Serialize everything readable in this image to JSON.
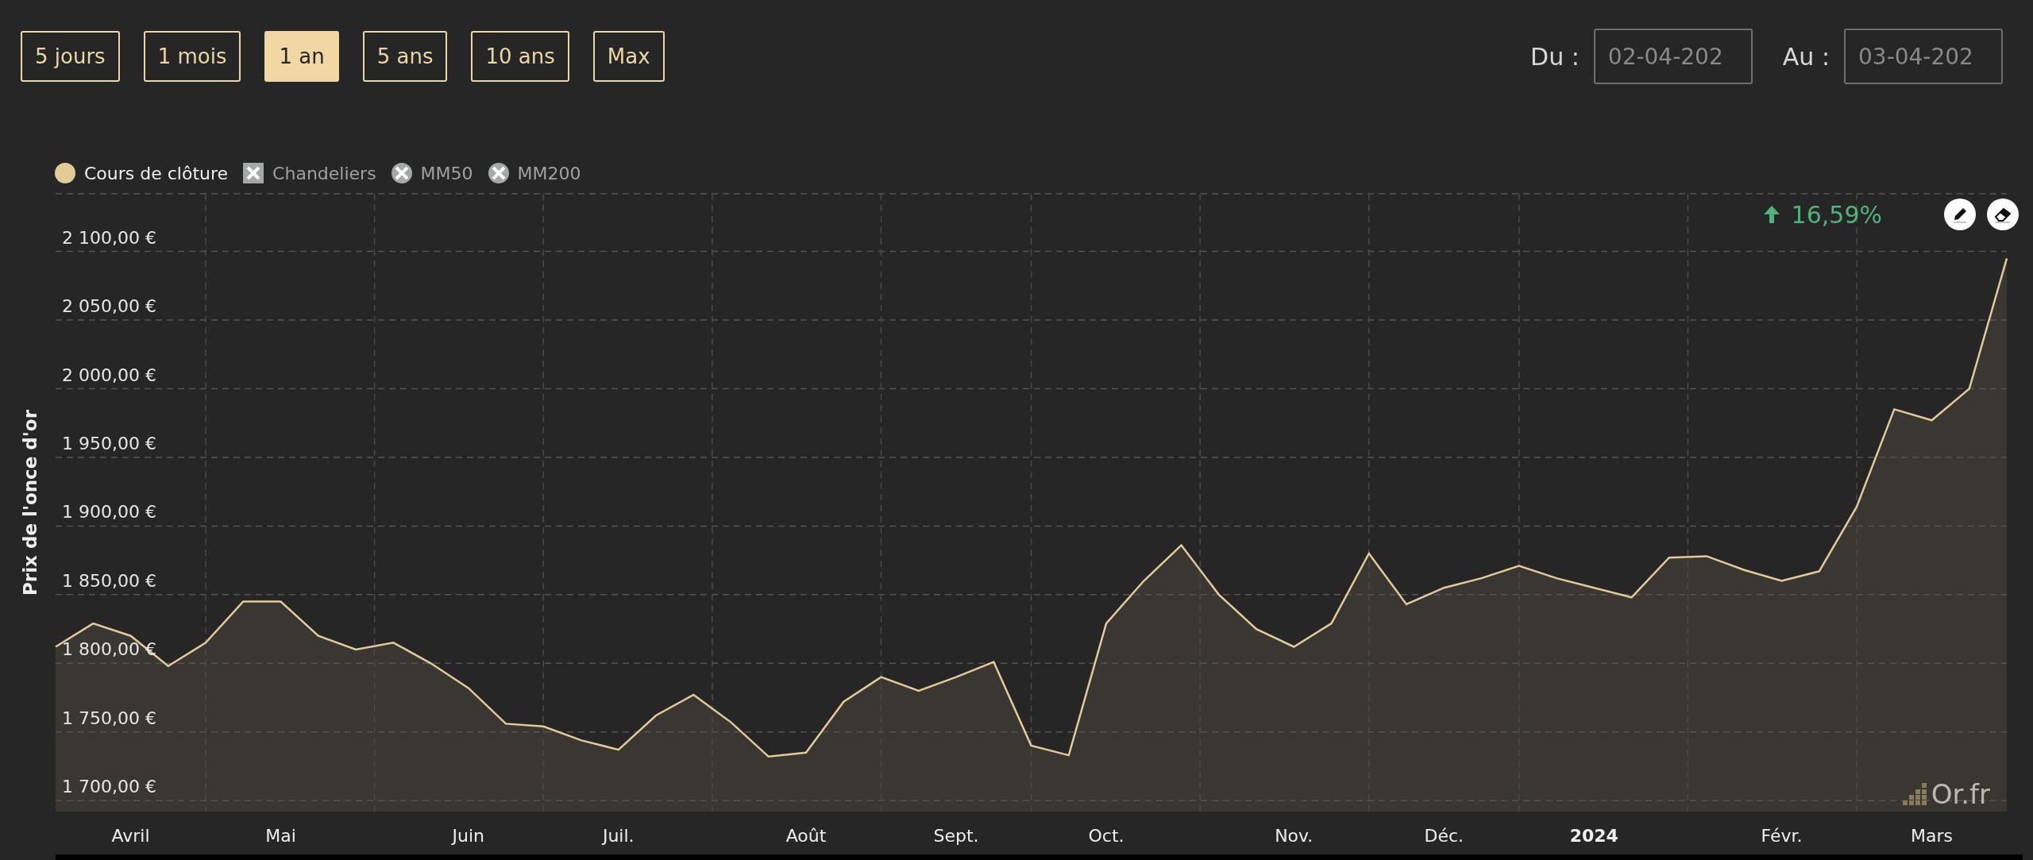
{
  "periods": [
    {
      "label": "5 jours",
      "selected": false
    },
    {
      "label": "1 mois",
      "selected": false
    },
    {
      "label": "1 an",
      "selected": true
    },
    {
      "label": "5 ans",
      "selected": false
    },
    {
      "label": "10 ans",
      "selected": false
    },
    {
      "label": "Max",
      "selected": false
    }
  ],
  "date_range": {
    "from_label": "Du :",
    "from_value": "02-04-202",
    "to_label": "Au :",
    "to_value": "03-04-202"
  },
  "legend": [
    {
      "kind": "circle",
      "enabled": true
    },
    {
      "label": "Chandeliers",
      "kind": "square",
      "enabled": false
    },
    {
      "label": "MM50",
      "kind": "circle",
      "enabled": false
    },
    {
      "label": "MM200",
      "kind": "circle",
      "enabled": false
    }
  ],
  "change": {
    "text": "16,59%"
  },
  "watermark_logo": "Or.fr",
  "chart": {
    "chart_data": {
      "type": "area",
      "grid": true,
      "ylabel": "Prix de l'once d'or",
      "ylim": [
        1692,
        2142
      ],
      "yticks": [
        {
          "value": 1700,
          "label": "1 700,00 €"
        },
        {
          "value": 1750,
          "label": "1 750,00 €"
        },
        {
          "value": 1800,
          "label": "1 800,00 €"
        },
        {
          "value": 1850,
          "label": "1 850,00 €"
        },
        {
          "value": 1900,
          "label": "1 900,00 €"
        },
        {
          "value": 1950,
          "label": "1 950,00 €"
        },
        {
          "value": 2000,
          "label": "2 000,00 €"
        },
        {
          "value": 2050,
          "label": "2 050,00 €"
        },
        {
          "value": 2100,
          "label": "2 100,00 €"
        }
      ],
      "categories": [
        null,
        null,
        "Avril",
        null,
        null,
        null,
        "Mai",
        null,
        null,
        null,
        null,
        "Juin",
        null,
        null,
        null,
        "Juil.",
        null,
        null,
        null,
        null,
        "Août",
        null,
        null,
        null,
        "Sept.",
        null,
        null,
        null,
        "Oct.",
        null,
        null,
        null,
        null,
        "Nov.",
        null,
        null,
        null,
        "Déc.",
        null,
        null,
        null,
        "2024",
        null,
        null,
        null,
        null,
        "Févr.",
        null,
        null,
        null,
        "Mars",
        null,
        null
      ],
      "series": [
        {
          "name": "Cours de clôture",
          "color": "#e3cb95",
          "values": [
            1812,
            1829,
            1820,
            1798,
            1815,
            1845,
            1845,
            1820,
            1810,
            1815,
            1800,
            1782,
            1756,
            1754,
            1744,
            1737,
            1762,
            1777,
            1757,
            1732,
            1735,
            1772,
            1790,
            1780,
            1790,
            1801,
            1740,
            1733,
            1829,
            1860,
            1886,
            1850,
            1825,
            1812,
            1829,
            1880,
            1843,
            1855,
            1862,
            1871,
            1862,
            1855,
            1848,
            1877,
            1878,
            1868,
            1860,
            1867,
            1914,
            1985,
            1977,
            2000,
            2095
          ]
        }
      ]
    }
  }
}
